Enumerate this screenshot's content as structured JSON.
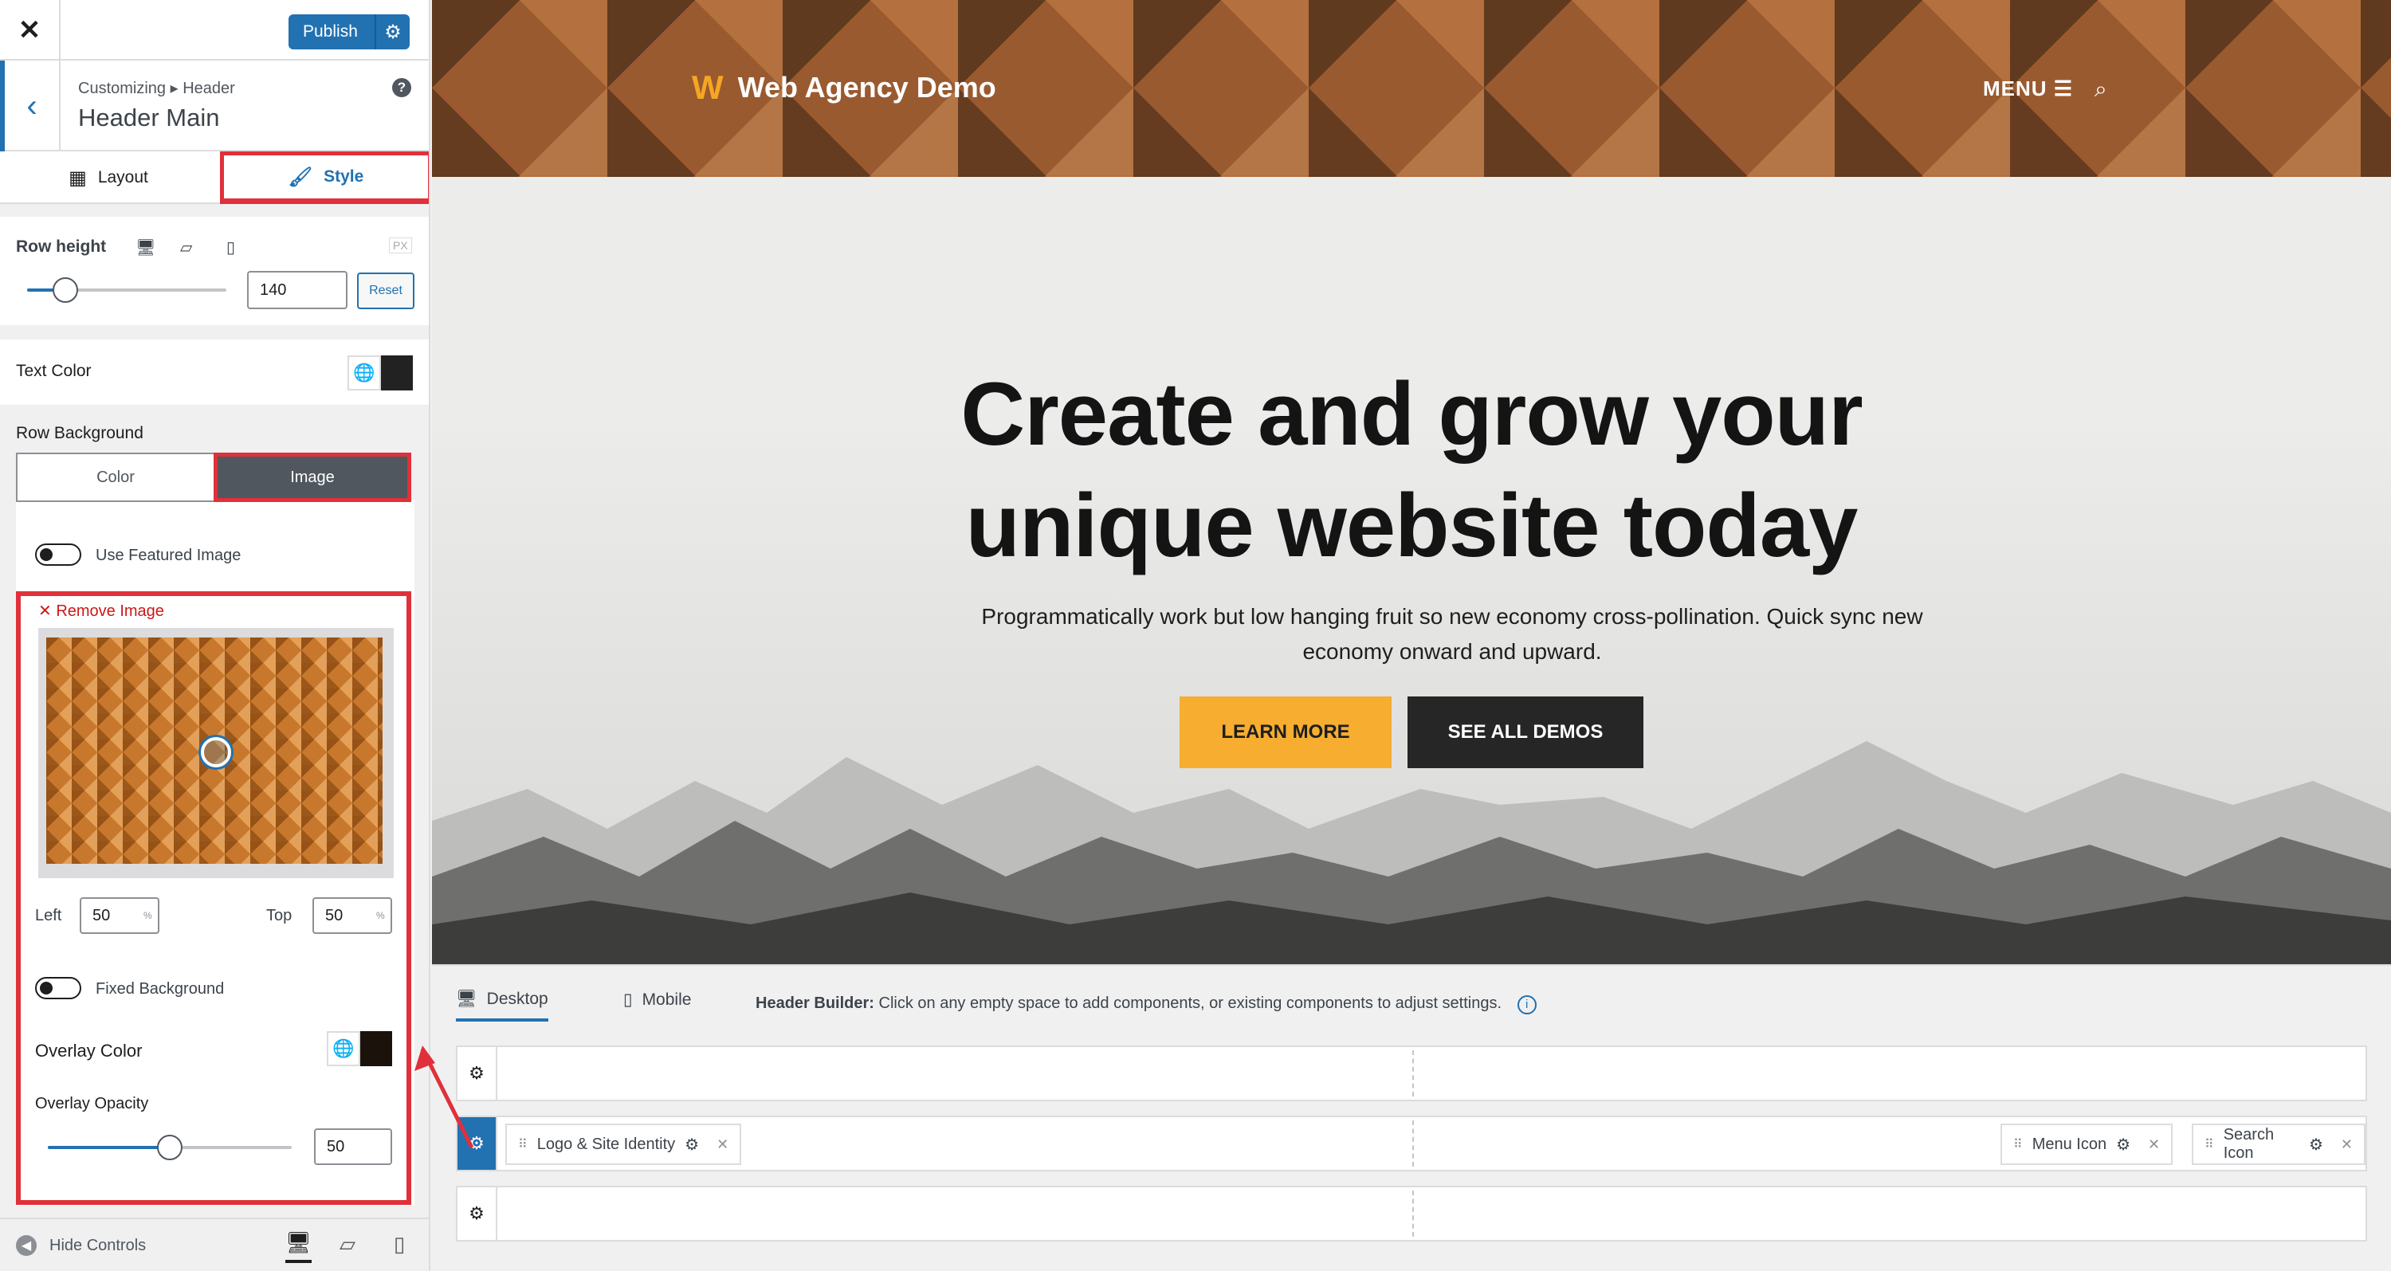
{
  "topbar": {
    "close_glyph": "✕",
    "publish_label": "Publish"
  },
  "section": {
    "breadcrumb": "Customizing ▸ Header",
    "title": "Header Main"
  },
  "tabs": [
    {
      "label": "Layout"
    },
    {
      "label": "Style"
    }
  ],
  "row_height": {
    "label": "Row height",
    "unit": "PX",
    "value": "140",
    "reset_label": "Reset",
    "level": 0.19
  },
  "text_color": {
    "label": "Text Color",
    "color": "#222222"
  },
  "row_background": {
    "label": "Row Background",
    "options": [
      "Color",
      "Image"
    ],
    "selected": "Image",
    "featured_label": "Use Featured Image",
    "remove_label": "✕ Remove Image",
    "left_label": "Left",
    "left_value": "50",
    "top_label": "Top",
    "top_value": "50",
    "percent": "%",
    "fixed_label": "Fixed Background",
    "overlay_color_label": "Overlay Color",
    "overlay_color": "#1a120b",
    "overlay_opacity_label": "Overlay Opacity",
    "overlay_opacity_value": "50",
    "overlay_opacity_level": 0.5
  },
  "bottom": {
    "hide_label": "Hide Controls"
  },
  "preview": {
    "site_name": "Web Agency Demo",
    "menu_label": "MENU ☰",
    "headline_line1": "Create and grow your",
    "headline_line2": "unique website today",
    "subtext_line1": "Programmatically work but low hanging fruit so new economy cross-pollination. Quick sync new",
    "subtext_line2": "economy onward and upward.",
    "primary_cta": "LEARN MORE",
    "secondary_cta": "SEE ALL DEMOS"
  },
  "builder": {
    "tab_desktop": "Desktop",
    "tab_mobile": "Mobile",
    "hint_bold": "Header Builder:",
    "hint_text": "Click on any empty space to add components, or existing components to adjust settings.",
    "components": [
      "Logo & Site Identity",
      "Menu Icon",
      "Search Icon"
    ]
  },
  "colors": {
    "accent": "#2271b1",
    "highlight": "#e0303a",
    "cta": "#f6ad30"
  }
}
